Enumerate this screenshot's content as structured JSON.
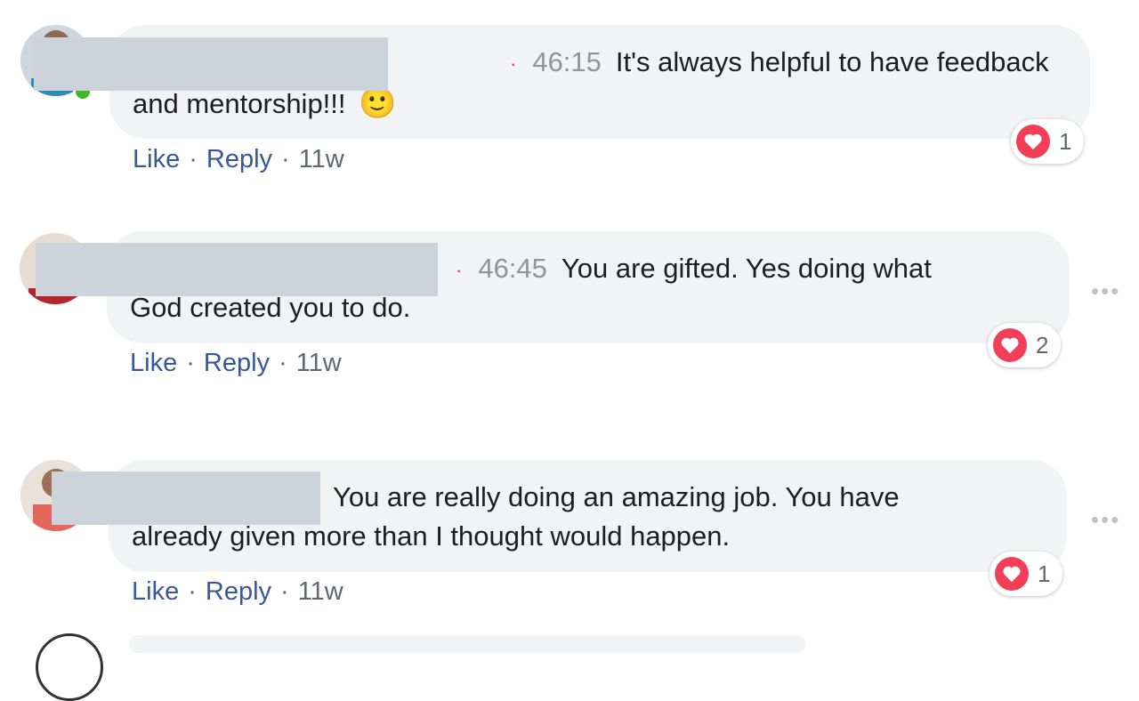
{
  "comments": [
    {
      "timestamp": "46:15",
      "text": "It's always helpful to have feedback",
      "text2": "and mentorship!!!",
      "emoji": "🙂",
      "reaction_count": "1",
      "like": "Like",
      "reply": "Reply",
      "age": "11w"
    },
    {
      "timestamp": "46:45",
      "text": "You are gifted. Yes doing what",
      "text2": "God created you to do.",
      "reaction_count": "2",
      "like": "Like",
      "reply": "Reply",
      "age": "11w",
      "more": "•••"
    },
    {
      "text": "You are really doing an amazing job. You have",
      "text2": "already given more than I thought would happen.",
      "reaction_count": "1",
      "like": "Like",
      "reply": "Reply",
      "age": "11w",
      "more": "•••"
    }
  ],
  "colors": {
    "bubble": "#f2f3f5",
    "link": "#385898",
    "heart": "#f33e58",
    "online": "#42b72a",
    "redaction": "#cdd3db"
  },
  "icons": {
    "reaction": "heart-icon",
    "more": "more-options-icon",
    "emoji": "slightly-smiling-face"
  }
}
